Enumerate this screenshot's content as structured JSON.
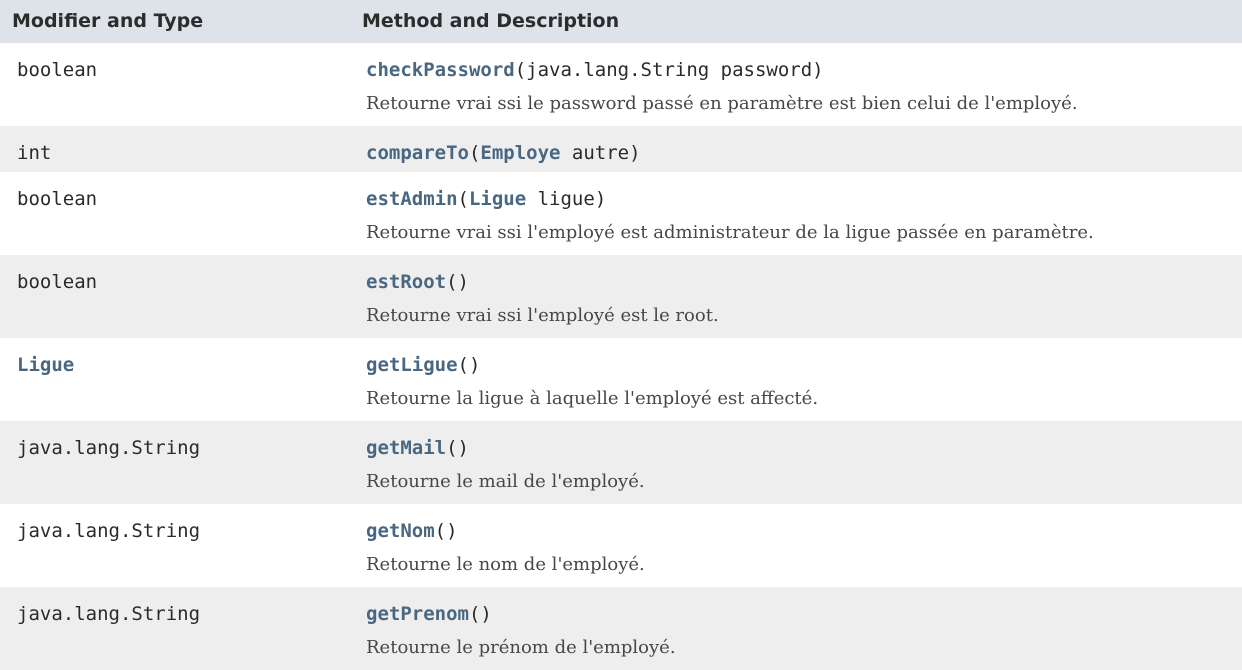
{
  "header": {
    "col1": "Modifier and Type",
    "col2": "Method and Description"
  },
  "rows": [
    {
      "type": "boolean",
      "method": "checkPassword",
      "open": "(",
      "params": "java.lang.String password",
      "close": ")",
      "description": "Retourne vrai ssi le password passé en paramètre est bien celui de l'employé."
    },
    {
      "type": "int",
      "method": "compareTo",
      "open": "(",
      "param_type": "Employe",
      "param_name": " autre",
      "close": ")",
      "description": ""
    },
    {
      "type": "boolean",
      "method": "estAdmin",
      "open": "(",
      "param_type": "Ligue",
      "param_name": " ligue",
      "close": ")",
      "description": "Retourne vrai ssi l'employé est administrateur de la ligue passée en paramètre."
    },
    {
      "type": "boolean",
      "method": "estRoot",
      "open": "(",
      "close": ")",
      "description": "Retourne vrai ssi l'employé est le root."
    },
    {
      "type": "Ligue",
      "method": "getLigue",
      "open": "(",
      "close": ")",
      "description": "Retourne la ligue à laquelle l'employé est affecté."
    },
    {
      "type": "java.lang.String",
      "method": "getMail",
      "open": "(",
      "close": ")",
      "description": "Retourne le mail de l'employé."
    },
    {
      "type": "java.lang.String",
      "method": "getNom",
      "open": "(",
      "close": ")",
      "description": "Retourne le nom de l'employé."
    },
    {
      "type": "java.lang.String",
      "method": "getPrenom",
      "open": "(",
      "close": ")",
      "description": "Retourne le prénom de l'employé."
    }
  ],
  "colors": {
    "header_bg": "#dee3e9",
    "alt_row_bg": "#eeeeef",
    "link": "#4a6782"
  }
}
